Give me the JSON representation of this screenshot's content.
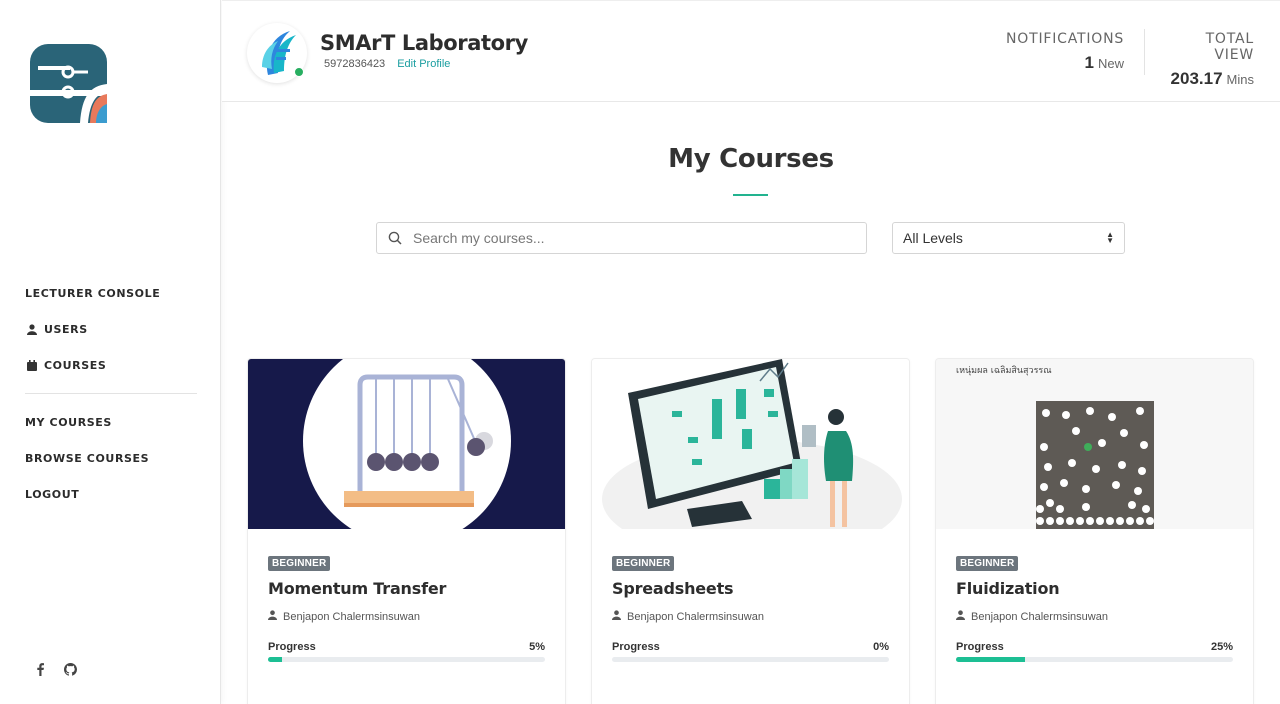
{
  "sidebar": {
    "console_title": "LECTURER CONSOLE",
    "items": [
      {
        "label": "USERS",
        "icon": "user-icon"
      },
      {
        "label": "COURSES",
        "icon": "calendar-icon"
      }
    ],
    "links": [
      "MY COURSES",
      "BROWSE COURSES",
      "LOGOUT"
    ],
    "social": [
      "facebook-icon",
      "github-icon"
    ]
  },
  "header": {
    "name": "SMArT Laboratory",
    "id": "5972836423",
    "edit_label": "Edit Profile",
    "notifications_label": "NOTIFICATIONS",
    "notifications_count": "1",
    "notifications_unit": "New",
    "total_view_label": "TOTAL VIEW",
    "total_view_value": "203.17",
    "total_view_unit": "Mins",
    "status_color": "#27ae60"
  },
  "main": {
    "title": "My Courses",
    "search_placeholder": "Search my courses...",
    "level_filter": "All Levels"
  },
  "courses": [
    {
      "badge": "BEGINNER",
      "title": "Momentum Transfer",
      "author": "Benjapon Chalermsinsuwan",
      "progress_label": "Progress",
      "progress_text": "5%",
      "progress": 5
    },
    {
      "badge": "BEGINNER",
      "title": "Spreadsheets",
      "author": "Benjapon Chalermsinsuwan",
      "progress_label": "Progress",
      "progress_text": "0%",
      "progress": 0
    },
    {
      "badge": "BEGINNER",
      "title": "Fluidization",
      "author": "Benjapon Chalermsinsuwan",
      "progress_label": "Progress",
      "progress_text": "25%",
      "progress": 25,
      "image_caption": "เหนุ่มผล เฉลิมสินสุวรรณ"
    }
  ],
  "colors": {
    "accent": "#22b38f",
    "progress": "#1dbf94",
    "badge": "#6c757d",
    "link": "#1a9ea0"
  }
}
